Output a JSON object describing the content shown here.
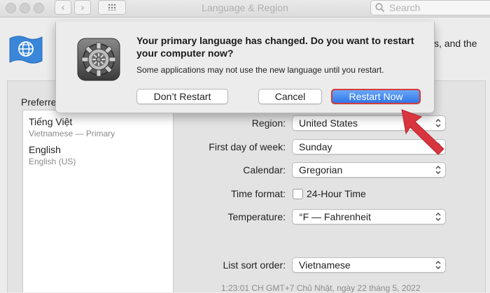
{
  "window": {
    "title": "Language & Region",
    "search_placeholder": "Search"
  },
  "description_tail": "s, and the",
  "preferred_languages_label": "Preferre",
  "languages": [
    {
      "name": "Tiếng Việt",
      "sub": "Vietnamese — Primary"
    },
    {
      "name": "English",
      "sub": "English (US)"
    }
  ],
  "settings": {
    "region": {
      "label": "Region:",
      "value": "United States"
    },
    "first_day": {
      "label": "First day of week:",
      "value": "Sunday"
    },
    "calendar": {
      "label": "Calendar:",
      "value": "Gregorian"
    },
    "time_format": {
      "label": "Time format:",
      "checkbox_label": "24-Hour Time",
      "checked": false
    },
    "temperature": {
      "label": "Temperature:",
      "value": "°F — Fahrenheit"
    },
    "list_sort": {
      "label": "List sort order:",
      "value": "Vietnamese"
    }
  },
  "date_sample": "1:23:01 CH GMT+7 Chủ Nhật, ngày 22 tháng 5, 2022",
  "dialog": {
    "title": "Your primary language has changed. Do you want to restart your computer now?",
    "body": "Some applications may not use the new language until you restart.",
    "buttons": {
      "dont_restart": "Don’t Restart",
      "cancel": "Cancel",
      "restart_now": "Restart Now"
    }
  },
  "colors": {
    "primary_button": "#3a82f0",
    "annotation_red": "#d8353f",
    "highlight_border": "#d23a3a"
  },
  "icons": {
    "app": "flag-globe-icon",
    "dialog": "gear-icon"
  }
}
